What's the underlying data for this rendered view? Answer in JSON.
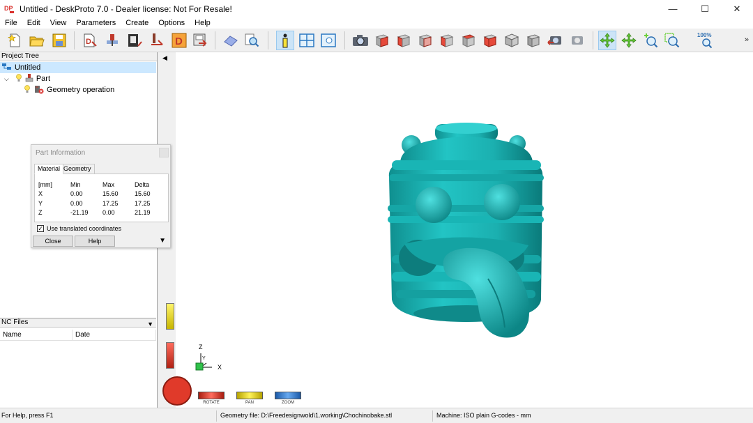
{
  "window": {
    "title": "Untitled - DeskProto 7.0 - Dealer license: Not For Resale!",
    "minimize": "—",
    "maximize": "☐",
    "close": "✕"
  },
  "menu": {
    "items": [
      "File",
      "Edit",
      "View",
      "Parameters",
      "Create",
      "Options",
      "Help"
    ]
  },
  "toolbar": {
    "zoom_label": "100%",
    "more": "»"
  },
  "project_tree": {
    "header": "Project Tree",
    "root": "Untitled",
    "part": "Part",
    "operation": "Geometry operation"
  },
  "nc_files": {
    "header": "NC Files",
    "columns": [
      "Name",
      "Date"
    ]
  },
  "part_info": {
    "title": "Part Information",
    "tabs": [
      "Material",
      "Geometry"
    ],
    "active_tab": "Material",
    "header": [
      "[mm]",
      "Min",
      "Max",
      "Delta"
    ],
    "rows": [
      [
        "X",
        "0.00",
        "15.60",
        "15.60"
      ],
      [
        "Y",
        "0.00",
        "17.25",
        "17.25"
      ],
      [
        "Z",
        "-21.19",
        "0.00",
        "21.19"
      ]
    ],
    "checkbox_label": "Use translated coordinates",
    "checkbox_checked": true,
    "close_button": "Close",
    "help_button": "Help"
  },
  "view_controls": {
    "rotate": "ROTATE",
    "pan": "PAN",
    "zoom": "ZOOM",
    "axis_z": "Z",
    "axis_y": "Y",
    "axis_x": "X"
  },
  "status": {
    "help": "For Help, press F1",
    "geometry": "Geometry file: D:\\Freedesignwold\\1.working\\Chochinobake.stl",
    "machine": "Machine: ISO plain G-codes - mm"
  },
  "colors": {
    "model": "#1fb3b3",
    "selection": "#cce8ff",
    "active_tool": "#cce4f7"
  }
}
